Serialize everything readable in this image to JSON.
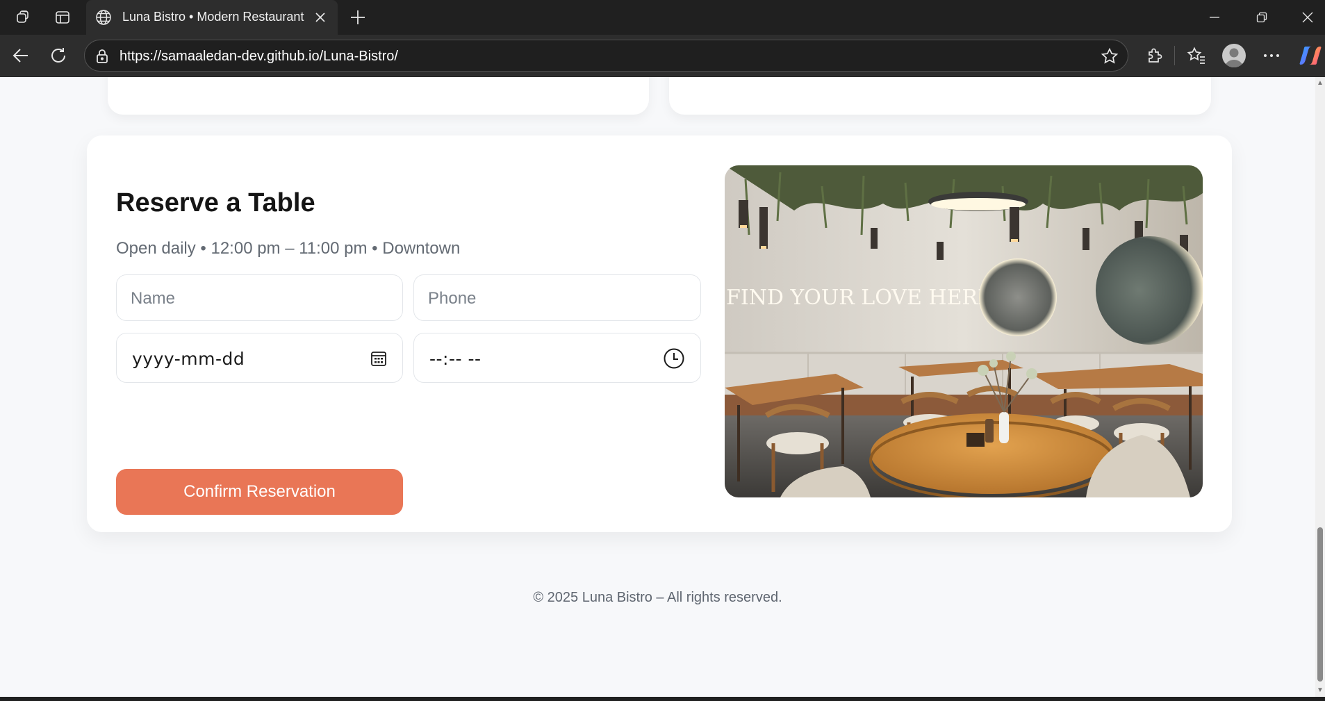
{
  "browser": {
    "tab_title": "Luna Bistro • Modern Restaurant",
    "url": "https://samaaledan-dev.github.io/Luna-Bistro/"
  },
  "reservation": {
    "title": "Reserve a Table",
    "subtitle": "Open daily • 12:00 pm – 11:00 pm • Downtown",
    "name_placeholder": "Name",
    "phone_placeholder": "Phone",
    "date_value": "yyyy-mm-dd",
    "time_value": "--:-- --",
    "confirm_label": "Confirm Reservation",
    "image_sign_text": "FIND YOUR LOVE HERE"
  },
  "footer": {
    "text": "© 2025 Luna Bistro – All rights reserved."
  },
  "colors": {
    "accent": "#e97656",
    "page_bg": "#f7f8fa",
    "card_bg": "#ffffff",
    "title_text": "#151515",
    "muted_text": "#636a73"
  },
  "icons": {
    "workspaces": "workspaces-icon",
    "tab_actions": "tab-actions-icon",
    "globe": "globe-icon",
    "close": "close-icon",
    "new_tab": "plus-icon",
    "back": "back-arrow-icon",
    "refresh": "refresh-icon",
    "lock": "lock-icon",
    "favorite": "star-icon",
    "extensions": "puzzle-icon",
    "favorites": "favorites-icon",
    "profile": "profile-icon",
    "more": "more-icon",
    "copilot": "copilot-icon",
    "calendar": "calendar-icon",
    "clock": "clock-icon"
  }
}
